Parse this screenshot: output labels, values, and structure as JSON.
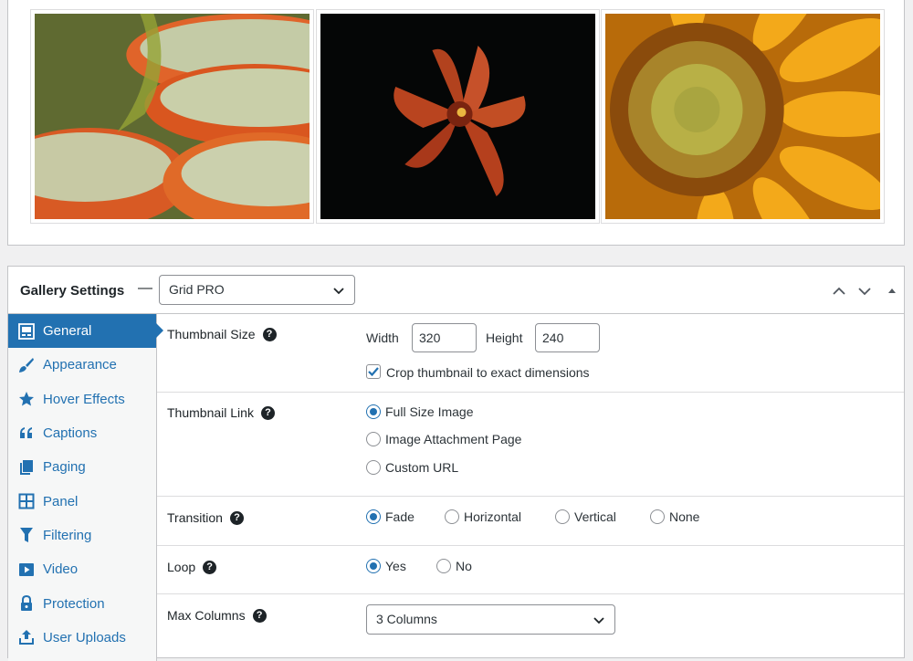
{
  "gallery": {
    "images": [
      {
        "name": "lily-pads-image"
      },
      {
        "name": "red-lily-image"
      },
      {
        "name": "sunflower-image"
      }
    ]
  },
  "settings": {
    "title": "Gallery Settings",
    "template_select": {
      "value": "Grid PRO"
    },
    "header_buttons": [
      "move-up-icon",
      "move-down-icon",
      "toggle-panel-icon"
    ]
  },
  "sidebar": {
    "items": [
      {
        "label": "General",
        "icon": "general-icon",
        "active": true
      },
      {
        "label": "Appearance",
        "icon": "brush-icon"
      },
      {
        "label": "Hover Effects",
        "icon": "star-icon"
      },
      {
        "label": "Captions",
        "icon": "quote-icon"
      },
      {
        "label": "Paging",
        "icon": "pages-icon"
      },
      {
        "label": "Panel",
        "icon": "panel-icon"
      },
      {
        "label": "Filtering",
        "icon": "filter-icon"
      },
      {
        "label": "Video",
        "icon": "video-icon"
      },
      {
        "label": "Protection",
        "icon": "lock-icon"
      },
      {
        "label": "User Uploads",
        "icon": "upload-icon"
      }
    ]
  },
  "fields": {
    "thumbnail_size": {
      "label": "Thumbnail Size",
      "width_label": "Width",
      "width_value": "320",
      "height_label": "Height",
      "height_value": "240",
      "crop_label": "Crop thumbnail to exact dimensions",
      "crop_checked": true
    },
    "thumbnail_link": {
      "label": "Thumbnail Link",
      "options": [
        "Full Size Image",
        "Image Attachment Page",
        "Custom URL"
      ],
      "selected": "Full Size Image"
    },
    "transition": {
      "label": "Transition",
      "options": [
        "Fade",
        "Horizontal",
        "Vertical",
        "None"
      ],
      "selected": "Fade"
    },
    "loop": {
      "label": "Loop",
      "options": [
        "Yes",
        "No"
      ],
      "selected": "Yes"
    },
    "max_columns": {
      "label": "Max Columns",
      "value": "3 Columns"
    }
  },
  "colors": {
    "accent": "#2271b1",
    "border": "#c3c4c7",
    "sidebar_bg": "#f6f7f7",
    "background": "#f0f0f1"
  }
}
